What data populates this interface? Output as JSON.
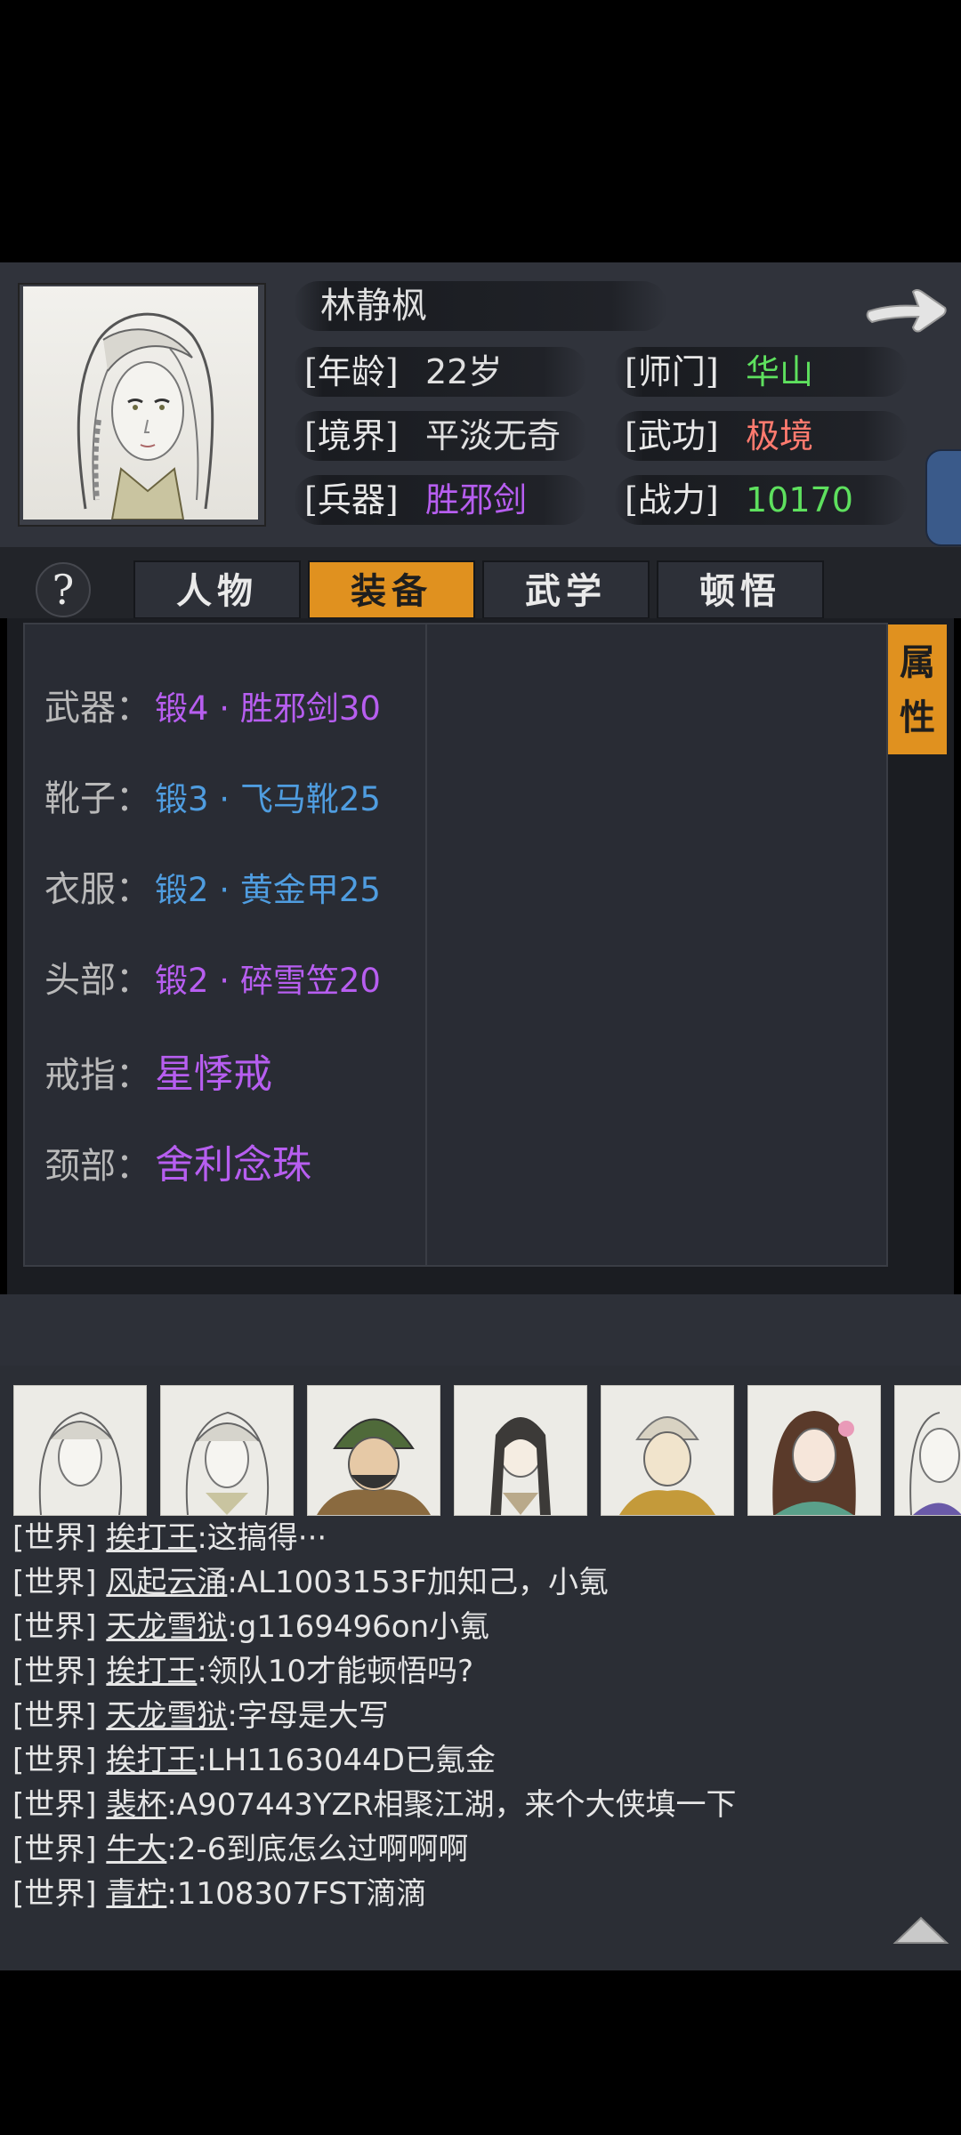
{
  "character": {
    "name": "林静枫",
    "stats": [
      {
        "label": "[年龄]",
        "value": "22岁",
        "color": "#e0e0e0"
      },
      {
        "label": "[师门]",
        "value": "华山",
        "color": "#5ee05e"
      },
      {
        "label": "[境界]",
        "value": "平淡无奇",
        "color": "#e0e0e0"
      },
      {
        "label": "[武功]",
        "value": "极境",
        "color": "#ff7a6e"
      },
      {
        "label": "[兵器]",
        "value": "胜邪剑",
        "color": "#b75ef0"
      },
      {
        "label": "[战力]",
        "value": "10170",
        "color": "#5ee05e"
      }
    ]
  },
  "tabs": {
    "help": "?",
    "items": [
      "人物",
      "装备",
      "武学",
      "顿悟"
    ],
    "active_index": 1
  },
  "equipment": [
    {
      "label": "武器：",
      "value": "锻4 · 胜邪剑30",
      "quality": "purple"
    },
    {
      "label": "靴子：",
      "value": "锻3 · 飞马靴25",
      "quality": "blue"
    },
    {
      "label": "衣服：",
      "value": "锻2 · 黄金甲25",
      "quality": "blue"
    },
    {
      "label": "头部：",
      "value": "锻2 · 碎雪笠20",
      "quality": "purple"
    },
    {
      "label": "戒指：",
      "value": "星悸戒",
      "quality": "purple"
    },
    {
      "label": "颈部：",
      "value": "舍利念珠",
      "quality": "purple"
    }
  ],
  "side_tab": {
    "line1": "属",
    "line2": "性"
  },
  "chat": {
    "channel": "[世界]",
    "messages": [
      {
        "user": "挨打王",
        "text": ":这搞得···"
      },
      {
        "user": "风起云涌",
        "text": ":AL1003153F加知己，小氪"
      },
      {
        "user": "天龙雪狱",
        "text": ":g1169496on小氪"
      },
      {
        "user": "挨打王",
        "text": ":领队10才能顿悟吗?"
      },
      {
        "user": "天龙雪狱",
        "text": ":字母是大写"
      },
      {
        "user": "挨打王",
        "text": ":LH1163044D已氪金"
      },
      {
        "user": "裴杯",
        "text": ":A907443YZR相聚江湖，来个大侠填一下"
      },
      {
        "user": "牛大",
        "text": ":2-6到底怎么过啊啊啊"
      },
      {
        "user": "青柠",
        "text": ":1108307FST滴滴"
      }
    ]
  },
  "colors": {
    "accent": "#e0911f",
    "purple_quality": "#b75ef0",
    "blue_quality": "#4f9de0",
    "green_value": "#5ee05e",
    "red_value": "#ff7a6e"
  },
  "icons": [
    "right-arrow-icon",
    "help-icon",
    "scroll-up-icon"
  ]
}
